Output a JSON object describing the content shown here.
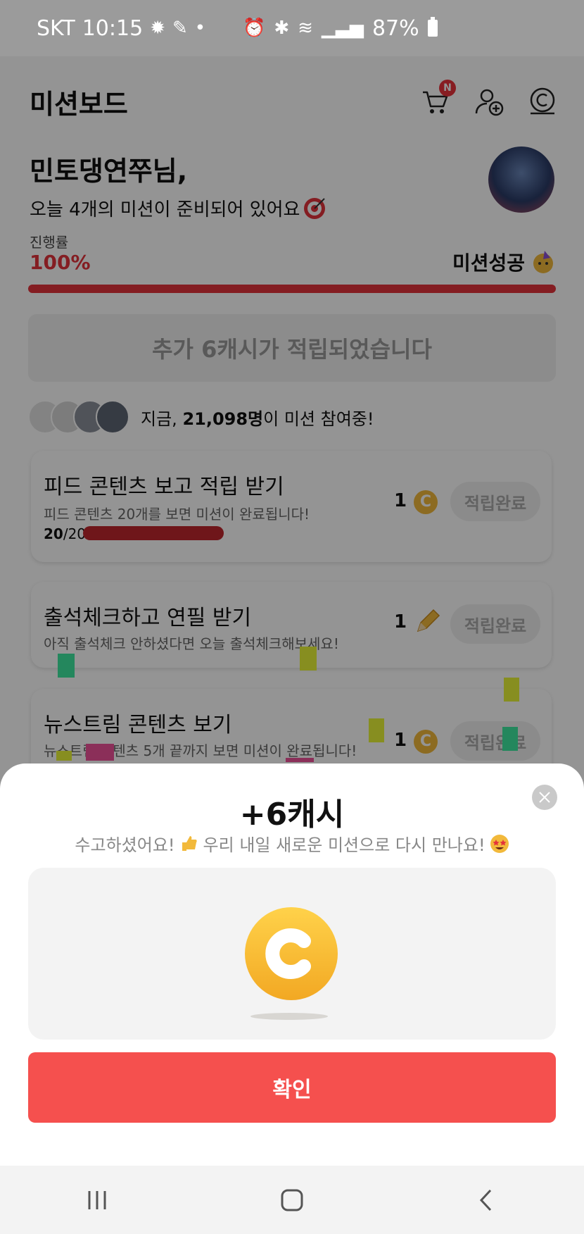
{
  "status_bar": {
    "carrier": "SKT",
    "time": "10:15",
    "battery": "87%"
  },
  "header": {
    "title": "미션보드",
    "cart_badge": "N"
  },
  "greeting": {
    "name": "민토댕연쭈님,",
    "message": "오늘 4개의 미션이 준비되어 있어요"
  },
  "progress": {
    "label": "진행률",
    "value": "100%",
    "fraction": 1.0,
    "status": "미션성공"
  },
  "added_banner": "추가 6캐시가 적립되었습니다",
  "participants": {
    "prefix": "지금,",
    "count": "21,098명",
    "suffix": "이 미션 참여중!"
  },
  "missions": [
    {
      "title": "피드 콘텐츠 보고 적립 받기",
      "desc": "피드 콘텐츠 20개를 보면 미션이 완료됩니다!",
      "reward": "1",
      "reward_icon": "coin-icon",
      "done_current": "20",
      "done_total": "/20",
      "button": "적립완료"
    },
    {
      "title": "출석체크하고 연필 받기",
      "desc": "아직 출석체크 안하셨다면 오늘 출석체크해보세요!",
      "reward": "1",
      "reward_icon": "pencil-icon",
      "button": "적립완료"
    },
    {
      "title": "뉴스트림 콘텐츠 보기",
      "desc": "뉴스트림 콘텐츠 5개 끝까지 보면 미션이 완료됩니다!",
      "reward": "1",
      "reward_icon": "coin-icon",
      "button": "적립완료"
    }
  ],
  "sheet": {
    "amount": "+6캐시",
    "msg_part1": "수고하셨어요!",
    "msg_part2": "우리 내일 새로운 미션으로 다시 만나요!",
    "confirm": "확인"
  },
  "colors": {
    "accent": "#e4333b",
    "confirm": "#f5504e",
    "coin": "#f2b93b"
  }
}
